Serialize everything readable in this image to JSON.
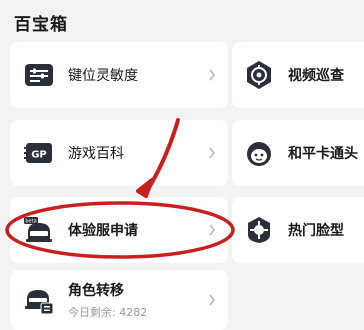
{
  "section": {
    "title": "百宝箱"
  },
  "items": [
    {
      "label": "键位灵敏度",
      "icon": "keyboard-sliders-icon"
    },
    {
      "label": "视频巡查",
      "icon": "video-target-icon"
    },
    {
      "label": "游戏百科",
      "icon": "gp-book-icon"
    },
    {
      "label": "和平卡通头",
      "icon": "cartoon-avatar-icon"
    },
    {
      "label": "体验服申请",
      "icon": "helmet-beta-icon"
    },
    {
      "label": "热门脸型",
      "icon": "face-shape-icon"
    },
    {
      "label": "角色转移",
      "icon": "character-transfer-icon",
      "sub": "今日剩余: 4282"
    }
  ],
  "annotation": {
    "color": "#c8201f"
  }
}
